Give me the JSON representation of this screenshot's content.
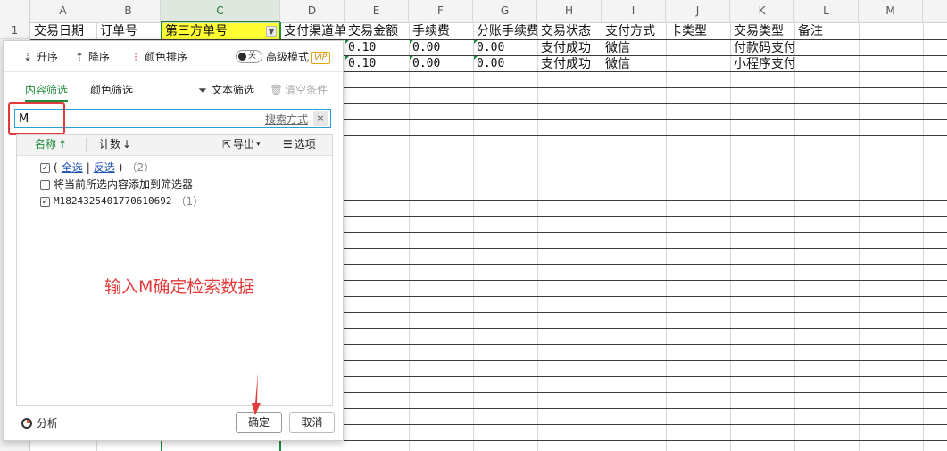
{
  "sheet": {
    "columns": [
      "A",
      "B",
      "C",
      "D",
      "E",
      "F",
      "G",
      "H",
      "I",
      "J",
      "K",
      "L",
      "M"
    ],
    "selected_column": "C",
    "row_numbers": [
      "1"
    ],
    "header_row": [
      "交易日期",
      "订单号",
      "第三方单号",
      "支付渠道单",
      "交易金额",
      "手续费",
      "分账手续费",
      "交易状态",
      "支付方式",
      "卡类型",
      "交易类型",
      "备注"
    ],
    "data_rows": [
      {
        "amount": "0.10",
        "fee": "0.00",
        "split_fee": "0.00",
        "status": "支付成功",
        "method": "微信",
        "type": "付款码支付"
      },
      {
        "amount": "0.10",
        "fee": "0.00",
        "split_fee": "0.00",
        "status": "支付成功",
        "method": "微信",
        "type": "小程序支付"
      }
    ],
    "filter_dropdown_icon": "triangle-down-icon"
  },
  "panel": {
    "toolbar": {
      "sort_asc": "升序",
      "sort_desc": "降序",
      "color_sort": "颜色排序",
      "toggle_label": "关",
      "advanced_mode": "高级模式",
      "vip_badge": "VIP"
    },
    "tabs": {
      "content_filter": "内容筛选",
      "color_filter": "颜色筛选",
      "text_filter": "文本筛选",
      "clear_conditions": "清空条件"
    },
    "search": {
      "value": "M",
      "mode_label": "搜索方式",
      "clear_icon": "×"
    },
    "list_header": {
      "name": "名称",
      "count": "计数",
      "export": "导出",
      "options": "选项"
    },
    "items": {
      "select_all": "全选",
      "separator": "|",
      "invert": "反选",
      "select_all_count": "（2）",
      "add_to_filter": "将当前所选内容添加到筛选器",
      "value_item": "M1824325401770610692",
      "value_item_count": "（1）"
    },
    "analysis": "分析",
    "ok_button": "确定",
    "cancel_button": "取消"
  },
  "annotation": {
    "text": "输入M确定检索数据",
    "color": "#e23b3b"
  },
  "colors": {
    "accent_green": "#1f8c3a",
    "highlight_yellow": "#ffff33",
    "search_border": "#2a9ed8"
  }
}
